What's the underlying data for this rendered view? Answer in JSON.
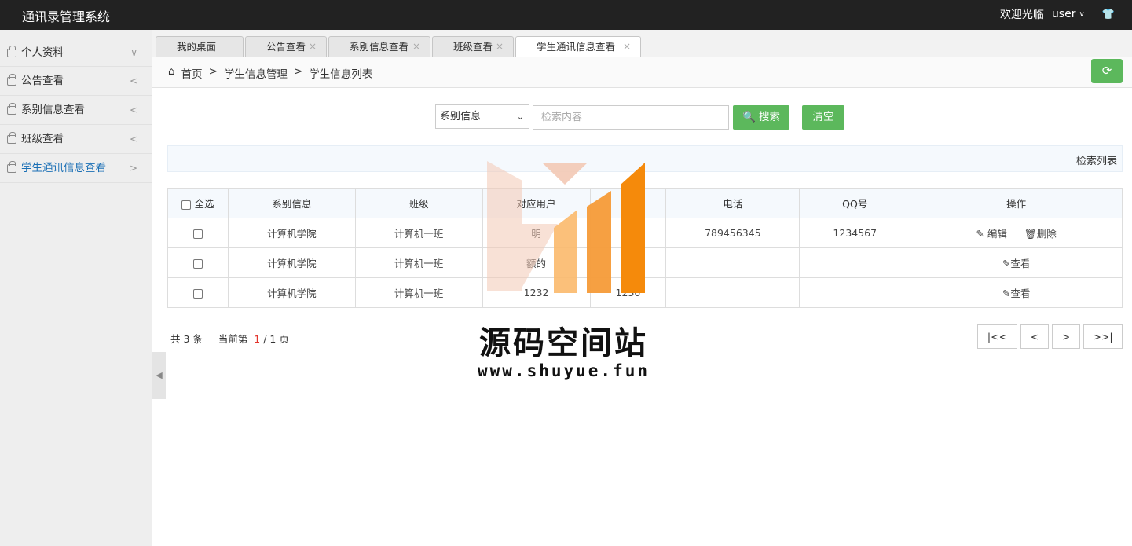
{
  "header": {
    "app_title": "通讯录管理系统",
    "welcome": "欢迎光临",
    "user": "user",
    "chevron": "∨",
    "shirt_icon": "👕"
  },
  "sidebar": {
    "items": [
      {
        "label": "个人资料",
        "arrow": "∨"
      },
      {
        "label": "公告查看",
        "arrow": "<"
      },
      {
        "label": "系别信息查看",
        "arrow": "<"
      },
      {
        "label": "班级查看",
        "arrow": "<"
      },
      {
        "label": "学生通讯信息查看",
        "arrow": ">"
      }
    ],
    "collapse_icon": "◀"
  },
  "tabs": [
    {
      "label": "我的桌面",
      "close": ""
    },
    {
      "label": "公告查看",
      "close": "×"
    },
    {
      "label": "系别信息查看",
      "close": "×"
    },
    {
      "label": "班级查看",
      "close": "×"
    },
    {
      "label": "学生通讯信息查看",
      "close": "×"
    }
  ],
  "breadcrumb": {
    "home_icon": "⌂",
    "home": "首页",
    "sep1": ">",
    "level1": "学生信息管理",
    "sep2": ">",
    "level2": "学生信息列表",
    "refresh_icon": "⟳"
  },
  "search": {
    "select_value": "系别信息",
    "caret": "⌄",
    "placeholder": "检索内容",
    "search_button": "🔍 搜索",
    "clear_button": "清空"
  },
  "list_title": "检索列表",
  "table": {
    "select_all": "全选",
    "headers": [
      "系别信息",
      "班级",
      "对应用户",
      "",
      "电话",
      "QQ号",
      "操作"
    ],
    "rows": [
      {
        "dept": "计算机学院",
        "class": "计算机一班",
        "user": "明",
        "col4": "",
        "phone": "789456345",
        "qq": "1234567",
        "actions": [
          "✎ 编辑",
          "🗑删除"
        ]
      },
      {
        "dept": "计算机学院",
        "class": "计算机一班",
        "user": "额的",
        "col4": "",
        "phone": "",
        "qq": "",
        "actions": [
          "✎查看"
        ]
      },
      {
        "dept": "计算机学院",
        "class": "计算机一班",
        "user": "1232",
        "col4": "1230",
        "phone": "",
        "qq": "",
        "actions": [
          "✎查看"
        ]
      }
    ]
  },
  "pager": {
    "total": "共 3 条",
    "page_label": "当前第",
    "current": "1",
    "sep": "/",
    "total_pages": "1 页",
    "first": "|<<",
    "prev": "<",
    "next": ">",
    "last": ">>|"
  },
  "watermark": {
    "title": "源码空间站",
    "url": "www.shuyue.fun",
    "colors": [
      "#f3c9b5",
      "#fbb96c",
      "#f59b38",
      "#f58a0b"
    ]
  }
}
